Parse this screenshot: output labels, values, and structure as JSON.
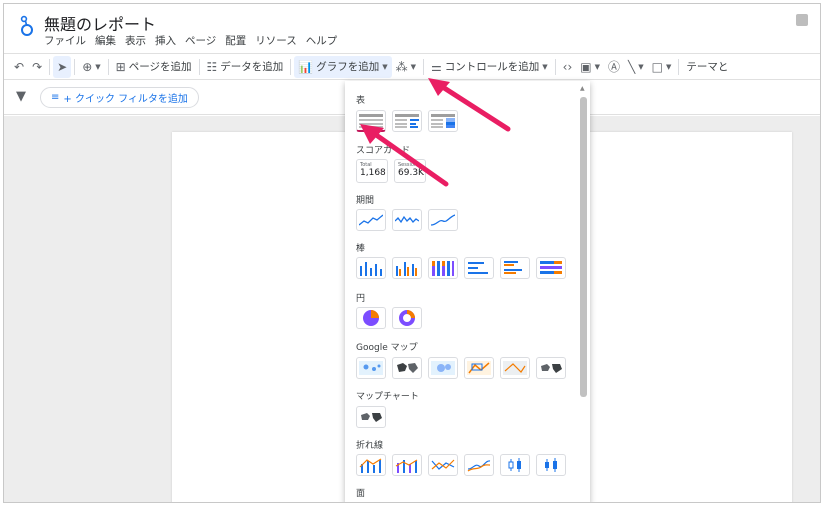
{
  "app": {
    "title": "無題のレポート",
    "menu": [
      "ファイル",
      "編集",
      "表示",
      "挿入",
      "ページ",
      "配置",
      "リソース",
      "ヘルプ"
    ]
  },
  "toolbar": {
    "add_page": "ページを追加",
    "add_data": "データを追加",
    "add_chart": "グラフを追加",
    "add_control": "コントロールを追加",
    "theme": "テーマと"
  },
  "filter": {
    "quick_filter": "+ クイック フィルタを追加"
  },
  "panel": {
    "sections": {
      "table": "表",
      "scorecard": "スコアカード",
      "timeseries": "期間",
      "bar": "棒",
      "pie": "円",
      "googlemaps": "Google マップ",
      "mapchart": "マップチャート",
      "line": "折れ線",
      "area": "面"
    },
    "scorecards": [
      {
        "label": "Total",
        "value": "1,168"
      },
      {
        "label": "Sessions",
        "value": "69.3K"
      }
    ]
  },
  "colors": {
    "accent": "#1a73e8",
    "orange": "#f57c00",
    "purple": "#7c4dff",
    "pink_arrow": "#e91e63"
  }
}
